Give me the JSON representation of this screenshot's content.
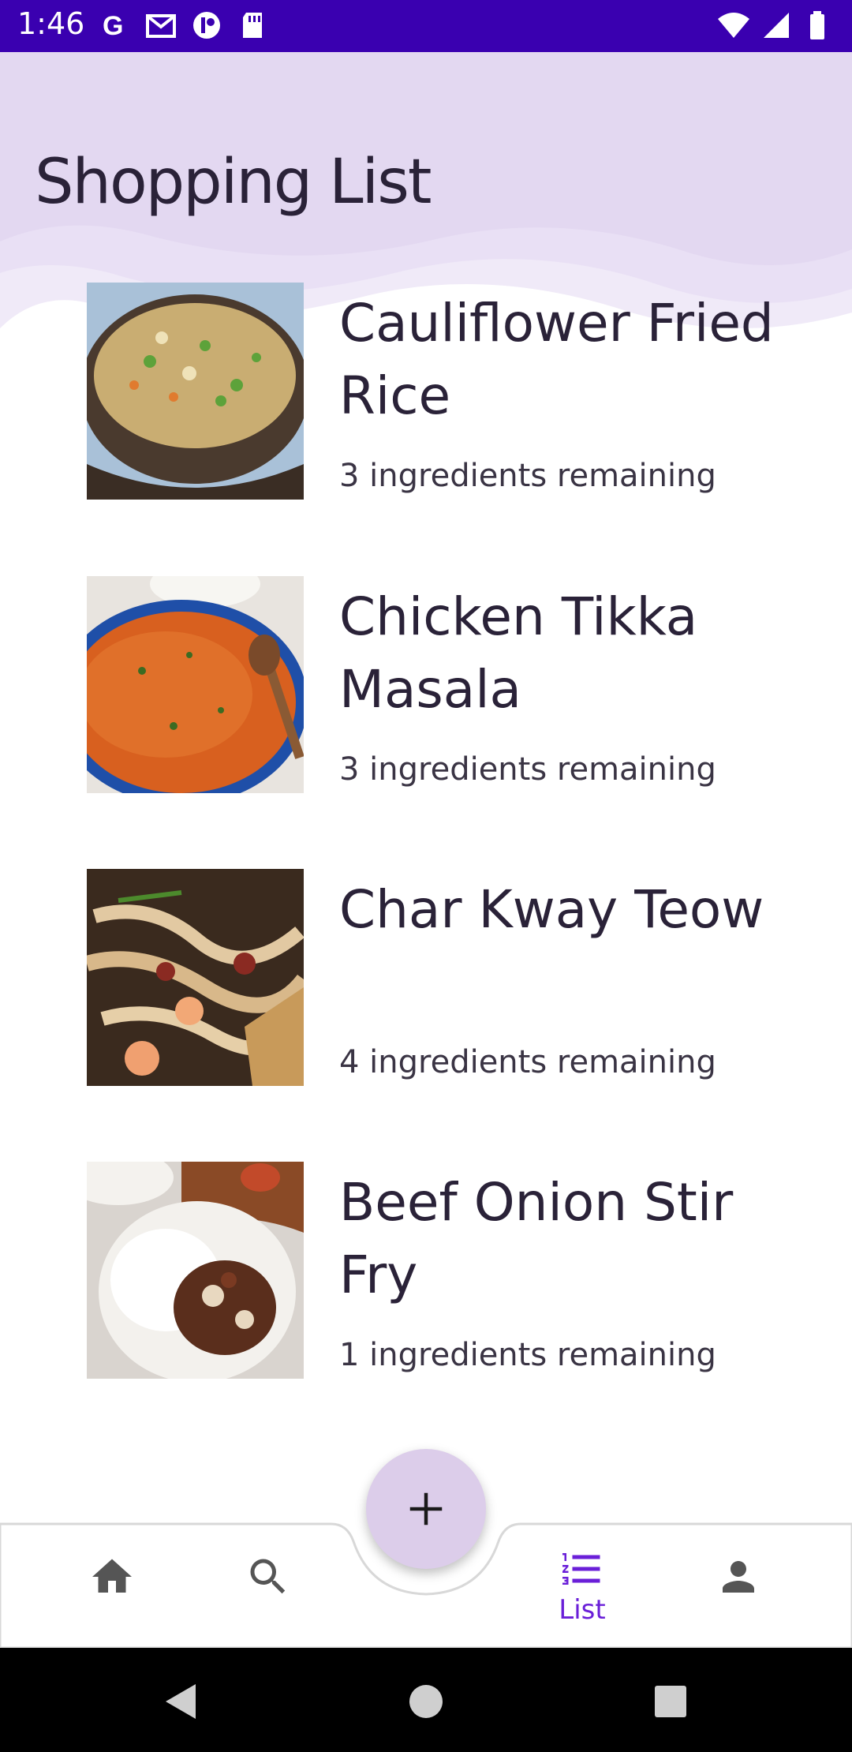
{
  "status_bar": {
    "time": "1:46"
  },
  "header": {
    "title": "Shopping List"
  },
  "recipes": [
    {
      "name": "Cauliflower Fried Rice",
      "remaining": "3 ingredients remaining"
    },
    {
      "name": "Chicken Tikka Masala",
      "remaining": "3 ingredients remaining"
    },
    {
      "name": "Char Kway Teow",
      "remaining": "4 ingredients remaining"
    },
    {
      "name": "Beef Onion Stir Fry",
      "remaining": "1 ingredients remaining"
    }
  ],
  "bottom_nav": {
    "items": [
      {
        "icon": "home-icon"
      },
      {
        "icon": "search-icon"
      },
      {
        "icon": "list-icon",
        "label": "List",
        "active": true
      },
      {
        "icon": "person-icon"
      }
    ],
    "fab_icon": "plus-icon"
  },
  "colors": {
    "status_bar": "#3a00b0",
    "accent": "#6a1fd8",
    "header_wave": "#e3d8f1",
    "fab": "#dccdea"
  }
}
